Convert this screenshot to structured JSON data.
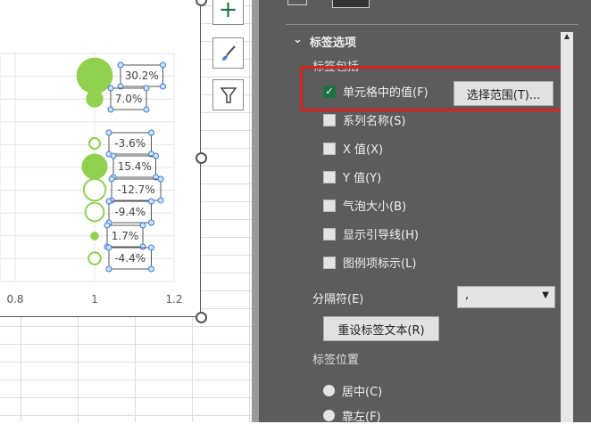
{
  "chart_data": {
    "type": "bubble",
    "x_ticks": [
      "0.8",
      "1",
      "1.2"
    ],
    "xlim": [
      0.8,
      1.2
    ],
    "points": [
      {
        "x": 1,
        "label": "30.2%",
        "size": 30.2,
        "filled": true
      },
      {
        "x": 1,
        "label": "7.0%",
        "size": 7.0,
        "filled": true
      },
      {
        "x": 1,
        "label": "-3.6%",
        "size": 3.6,
        "filled": false
      },
      {
        "x": 1,
        "label": "15.4%",
        "size": 15.4,
        "filled": true
      },
      {
        "x": 1,
        "label": "-12.7%",
        "size": 12.7,
        "filled": false
      },
      {
        "x": 1,
        "label": "-9.4%",
        "size": 9.4,
        "filled": false
      },
      {
        "x": 1,
        "label": "1.7%",
        "size": 1.7,
        "filled": true
      },
      {
        "x": 1,
        "label": "-4.4%",
        "size": 4.4,
        "filled": false
      }
    ],
    "color": "#92d050"
  },
  "chart_buttons": [
    "add-element",
    "style",
    "filter"
  ],
  "panel": {
    "section": "标签选项",
    "group": "标签包括",
    "options": [
      {
        "label": "单元格中的值(F)",
        "checked": true
      },
      {
        "label": "系列名称(S)",
        "checked": false
      },
      {
        "label": "X 值(X)",
        "checked": false
      },
      {
        "label": "Y 值(Y)",
        "checked": false
      },
      {
        "label": "气泡大小(B)",
        "checked": false
      },
      {
        "label": "显示引导线(H)",
        "checked": false
      },
      {
        "label": "图例项标示(L)",
        "checked": false
      }
    ],
    "select_range": "选择范围(T)...",
    "separator_label": "分隔符(E)",
    "separator_value": ",",
    "reset": "重设标签文本(R)",
    "position_label": "标签位置",
    "positions": [
      "居中(C)",
      "靠左(F)"
    ],
    "highlight_color": "#e02020"
  }
}
